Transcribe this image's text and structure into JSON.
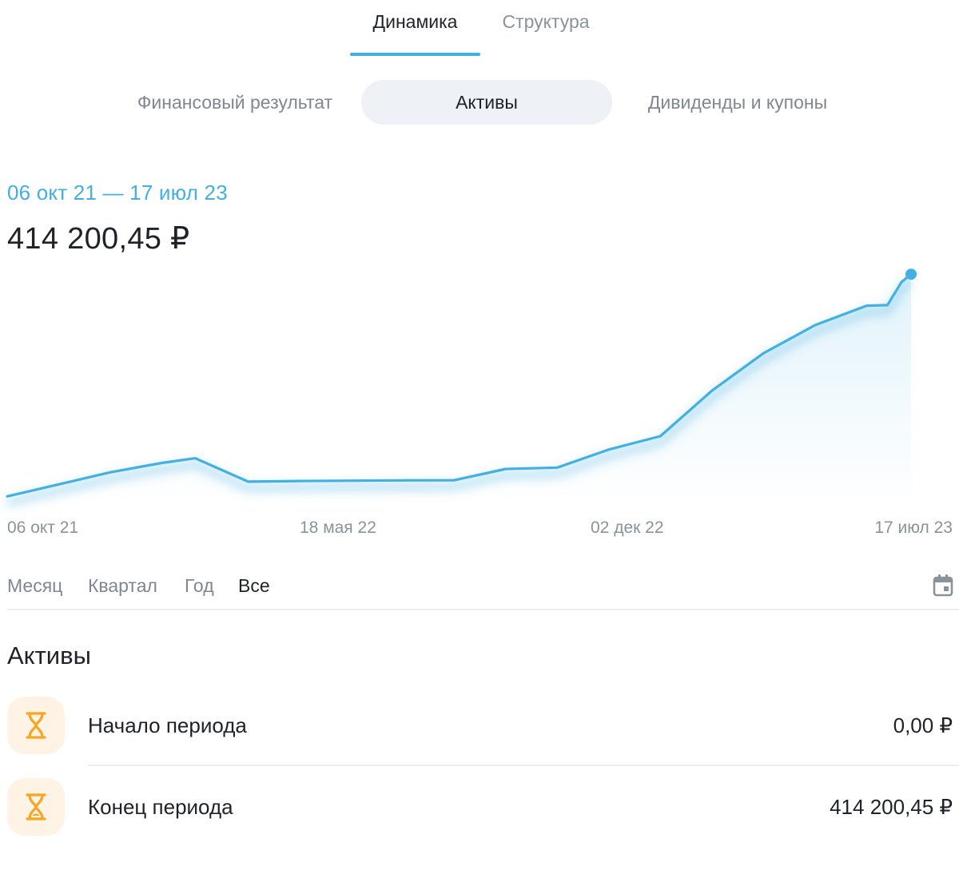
{
  "top_tabs": [
    {
      "label": "Динамика",
      "active": true
    },
    {
      "label": "Структура",
      "active": false
    }
  ],
  "segments": [
    {
      "label": "Финансовый результат",
      "active": false
    },
    {
      "label": "Активы",
      "active": true
    },
    {
      "label": "Дивиденды и купоны",
      "active": false
    }
  ],
  "summary": {
    "date_range": "06 окт 21 — 17 июл 23",
    "total": "414 200,45 ₽"
  },
  "chart_data": {
    "type": "area",
    "title": "",
    "xlabel": "",
    "ylabel": "",
    "grid": false,
    "legend": "none",
    "x_tick_labels": [
      "06 окт 21",
      "18 мая 22",
      "02 дек 22",
      "17 июл 23"
    ],
    "x_range": [
      "2021-10-06",
      "2023-07-17"
    ],
    "ylim": [
      0,
      430000
    ],
    "series": [
      {
        "color": "#42b0e2",
        "points": [
          {
            "x": "2021-10-06",
            "y": 82000
          },
          {
            "x": "2021-11-12",
            "y": 100000
          },
          {
            "x": "2021-12-19",
            "y": 118000
          },
          {
            "x": "2022-01-25",
            "y": 132000
          },
          {
            "x": "2022-02-18",
            "y": 139000
          },
          {
            "x": "2022-03-28",
            "y": 104000
          },
          {
            "x": "2022-05-04",
            "y": 105000
          },
          {
            "x": "2022-06-10",
            "y": 105500
          },
          {
            "x": "2022-07-17",
            "y": 106000
          },
          {
            "x": "2022-08-23",
            "y": 106200
          },
          {
            "x": "2022-09-29",
            "y": 123000
          },
          {
            "x": "2022-11-05",
            "y": 125000
          },
          {
            "x": "2022-12-12",
            "y": 152000
          },
          {
            "x": "2023-01-18",
            "y": 172000
          },
          {
            "x": "2023-02-24",
            "y": 240000
          },
          {
            "x": "2023-04-02",
            "y": 296000
          },
          {
            "x": "2023-05-09",
            "y": 338000
          },
          {
            "x": "2023-06-15",
            "y": 367000
          },
          {
            "x": "2023-06-30",
            "y": 368000
          },
          {
            "x": "2023-07-10",
            "y": 402000
          },
          {
            "x": "2023-07-17",
            "y": 414200.45
          }
        ]
      }
    ]
  },
  "period_filter": {
    "options": [
      {
        "label": "Месяц",
        "active": false
      },
      {
        "label": "Квартал",
        "active": false
      },
      {
        "label": "Год",
        "active": false
      },
      {
        "label": "Все",
        "active": true
      }
    ],
    "calendar_icon": "calendar-icon"
  },
  "assets": {
    "title": "Активы",
    "rows": [
      {
        "icon": "hourglass-icon",
        "label": "Начало периода",
        "value": "0,00 ₽"
      },
      {
        "icon": "hourglass-icon",
        "label": "Конец периода",
        "value": "414 200,45 ₽"
      }
    ]
  },
  "colors": {
    "accent": "#42b0e2",
    "text_primary": "#1f2229",
    "text_secondary": "#7f8792",
    "segment_active_bg": "#eef1f5",
    "icon_bg": "#fff3e5",
    "icon_color": "#f5a623"
  }
}
